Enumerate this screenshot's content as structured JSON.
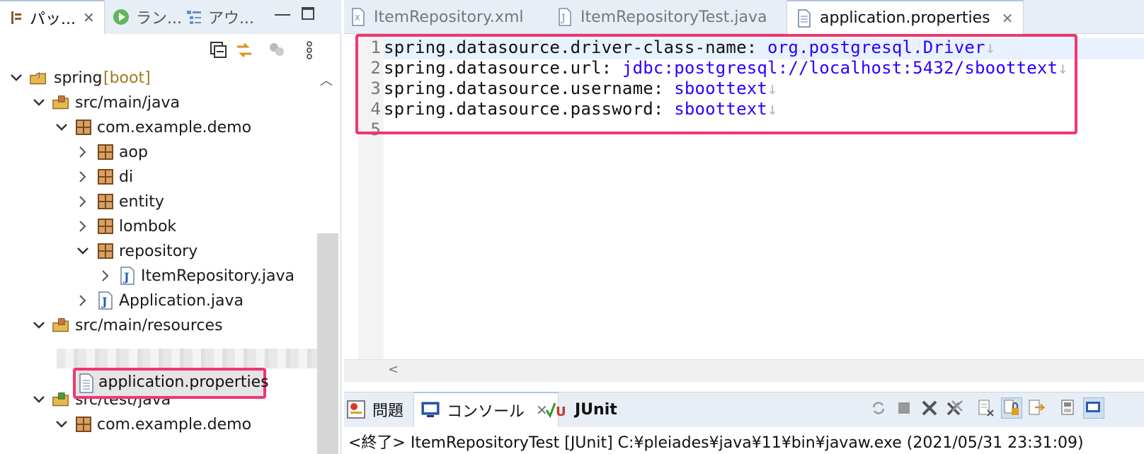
{
  "left_tabs": {
    "package_explorer": "パッ...",
    "launch": "ラン...",
    "outline": "アウ..."
  },
  "tree": {
    "project": "spring",
    "project_tag": "[boot]",
    "src_main_java": "src/main/java",
    "pkg_demo": "com.example.demo",
    "aop": "aop",
    "di": "di",
    "entity": "entity",
    "lombok": "lombok",
    "repository": "repository",
    "item_repository": "ItemRepository.java",
    "application_java": "Application.java",
    "src_main_resources": "src/main/resources",
    "application_properties": "application.properties",
    "src_test_java": "src/test/java",
    "test_pkg_demo": "com.example.demo"
  },
  "editor_tabs": {
    "tab1": "ItemRepository.xml",
    "tab2": "ItemRepositoryTest.java",
    "tab3": "application.properties"
  },
  "code": [
    {
      "num": "1",
      "key": "spring.datasource.driver-class-name",
      "sep": ": ",
      "value": "org.postgresql.Driver",
      "eol": "↓"
    },
    {
      "num": "2",
      "key": "spring.datasource.url",
      "sep": ": ",
      "value": "jdbc:postgresql://localhost:5432/sboottext",
      "eol": "↓"
    },
    {
      "num": "3",
      "key": "spring.datasource.username",
      "sep": ": ",
      "value": "sboottext",
      "eol": "↓"
    },
    {
      "num": "4",
      "key": "spring.datasource.password",
      "sep": ": ",
      "value": "sboottext",
      "eol": "↓"
    },
    {
      "num": "5",
      "key": "",
      "sep": "",
      "value": "",
      "eol": ""
    }
  ],
  "console_tabs": {
    "problems": "問題",
    "console": "コンソール",
    "junit": "JUnit"
  },
  "console": {
    "text": "<終了> ItemRepositoryTest [JUnit] C:¥pleiades¥java¥11¥bin¥javaw.exe (2021/05/31 23:31:09)"
  },
  "colors": {
    "highlight": "#f0376f",
    "value_blue": "#2a00ff",
    "tab_bar": "#e8eef6"
  }
}
